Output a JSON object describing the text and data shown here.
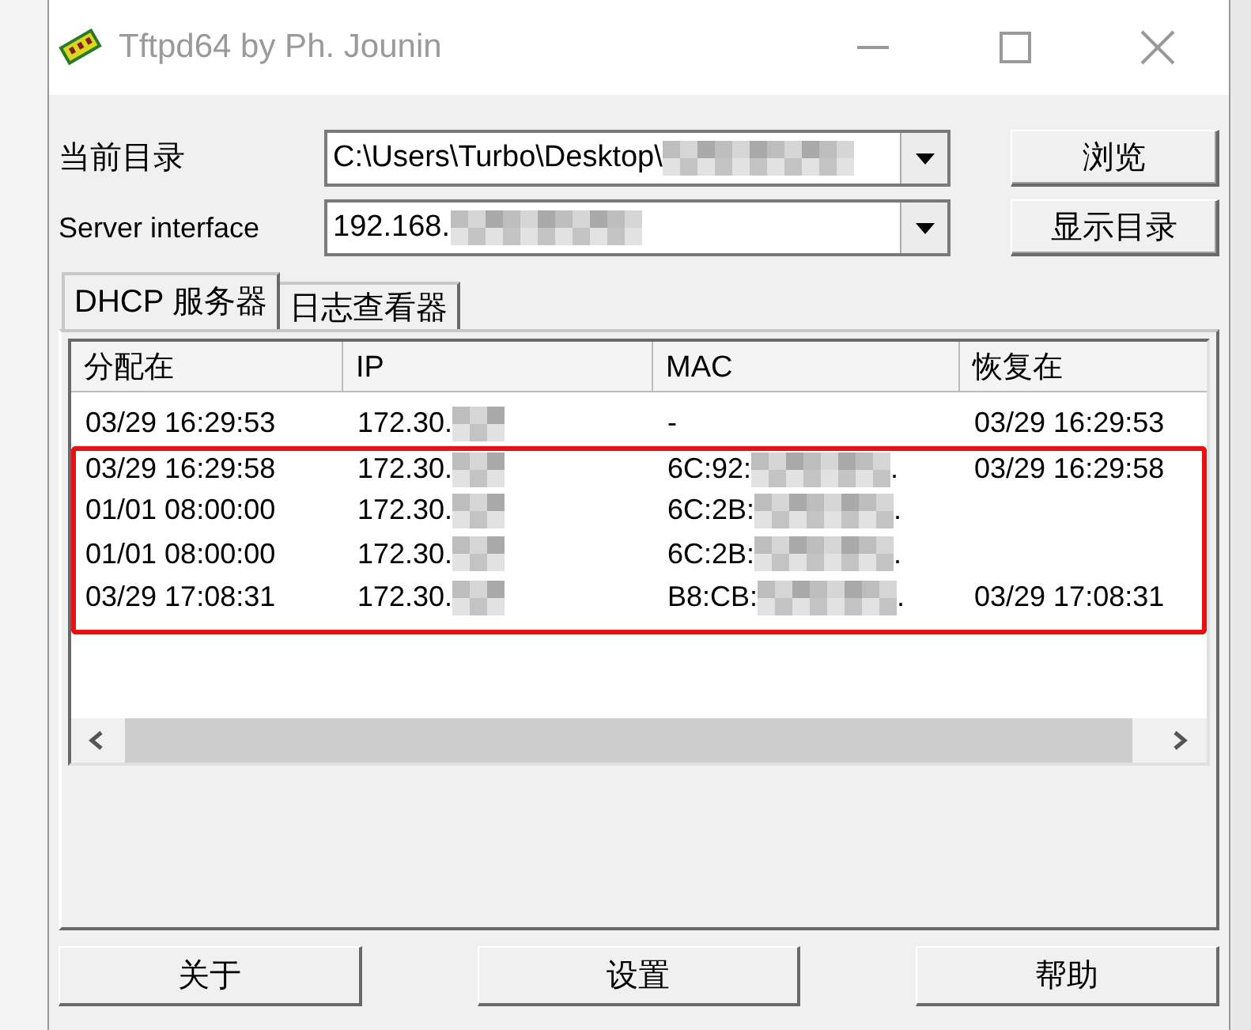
{
  "window": {
    "title": "Tftpd64 by Ph. Jounin"
  },
  "fields": [
    {
      "label": "当前目录",
      "value": "C:\\Users\\Turbo\\Desktop\\",
      "blurred": true,
      "button": "浏览"
    },
    {
      "label": "Server interface",
      "value": "192.168.",
      "blurred": true,
      "button": "显示目录"
    }
  ],
  "tabs": [
    {
      "label": "DHCP 服务器",
      "selected": true
    },
    {
      "label": "日志查看器",
      "selected": false
    }
  ],
  "table": {
    "columns": [
      "分配在",
      "IP",
      "MAC",
      "恢复在"
    ],
    "rows": [
      {
        "highlighted": false,
        "cells": [
          {
            "text": "03/29 16:29:53",
            "blurred": false
          },
          {
            "text": "172.30.",
            "blurred": true
          },
          {
            "text": "-",
            "blurred": false
          },
          {
            "text": "03/29 16:29:53",
            "blurred": false
          }
        ]
      },
      {
        "highlighted": true,
        "cells": [
          {
            "text": "03/29 16:29:58",
            "blurred": false
          },
          {
            "text": "172.30.",
            "blurred": true
          },
          {
            "text": "6C:92:",
            "blurred": true,
            "suffix": "."
          },
          {
            "text": "03/29 16:29:58",
            "blurred": false
          }
        ]
      },
      {
        "highlighted": true,
        "cells": [
          {
            "text": "01/01 08:00:00",
            "blurred": false
          },
          {
            "text": "172.30.",
            "blurred": true
          },
          {
            "text": "6C:2B:",
            "blurred": true,
            "suffix": "."
          }
        ]
      },
      {
        "highlighted": true,
        "cells": [
          {
            "text": "01/01 08:00:00",
            "blurred": false
          },
          {
            "text": "172.30.",
            "blurred": true
          },
          {
            "text": "6C:2B:",
            "blurred": true,
            "suffix": "."
          }
        ]
      },
      {
        "highlighted": true,
        "cells": [
          {
            "text": "03/29 17:08:31",
            "blurred": false
          },
          {
            "text": "172.30.",
            "blurred": true
          },
          {
            "text": "B8:CB:",
            "blurred": true,
            "suffix": "."
          },
          {
            "text": "03/29 17:08:31",
            "blurred": false
          }
        ]
      }
    ]
  },
  "buttons": [
    "关于",
    "设置",
    "帮助"
  ]
}
